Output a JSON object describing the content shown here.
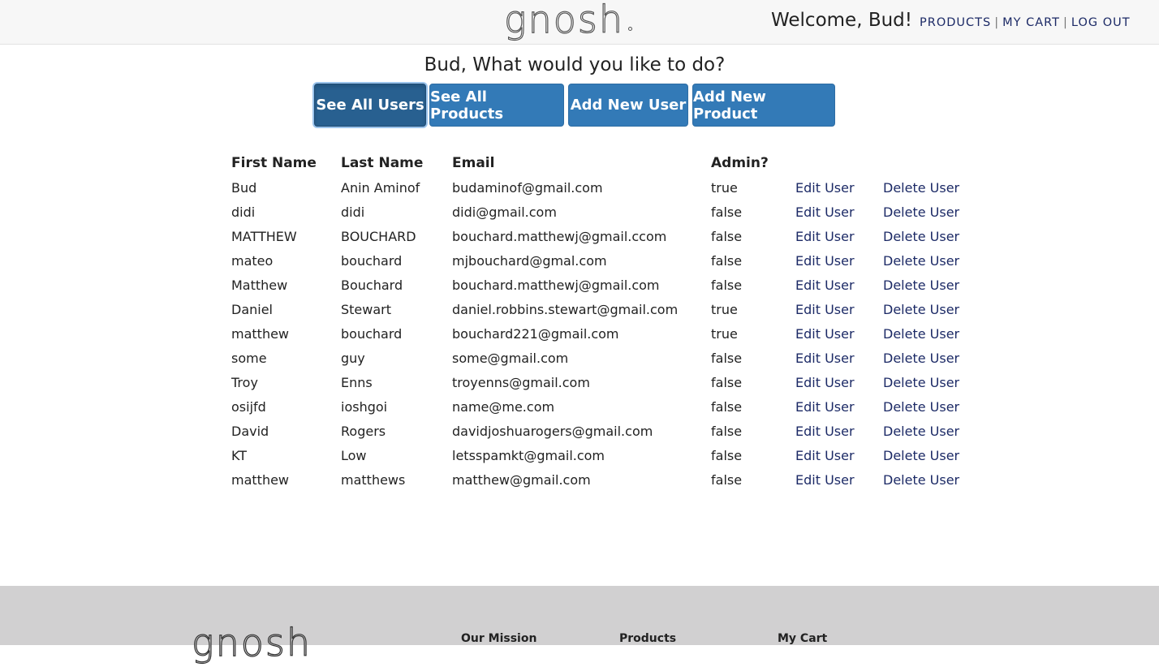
{
  "header": {
    "logo": "gnosh",
    "welcome": "Welcome, Bud!",
    "nav": [
      "PRODUCTS",
      "MY CART",
      "LOG OUT"
    ]
  },
  "prompt": "Bud, What would you like to do?",
  "actions": {
    "see_all_users": "See All Users",
    "see_all_products": "See All Products",
    "add_new_user": "Add New User",
    "add_new_product": "Add New Product"
  },
  "table": {
    "headers": [
      "First Name",
      "Last Name",
      "Email",
      "Admin?"
    ],
    "edit_label": "Edit User",
    "delete_label": "Delete User",
    "rows": [
      {
        "first": "Bud",
        "last": "Anin Aminof",
        "email": "budaminof@gmail.com",
        "admin": "true"
      },
      {
        "first": "didi",
        "last": "didi",
        "email": "didi@gmail.com",
        "admin": "false"
      },
      {
        "first": "MATTHEW",
        "last": "BOUCHARD",
        "email": "bouchard.matthewj@gmail.ccom",
        "admin": "false"
      },
      {
        "first": "mateo",
        "last": "bouchard",
        "email": "mjbouchard@gmal.com",
        "admin": "false"
      },
      {
        "first": "Matthew",
        "last": "Bouchard",
        "email": "bouchard.matthewj@gmail.com",
        "admin": "false"
      },
      {
        "first": "Daniel",
        "last": "Stewart",
        "email": "daniel.robbins.stewart@gmail.com",
        "admin": "true"
      },
      {
        "first": "matthew",
        "last": "bouchard",
        "email": "bouchard221@gmail.com",
        "admin": "true"
      },
      {
        "first": "some",
        "last": "guy",
        "email": "some@gmail.com",
        "admin": "false"
      },
      {
        "first": "Troy",
        "last": "Enns",
        "email": "troyenns@gmail.com",
        "admin": "false"
      },
      {
        "first": "osijfd",
        "last": "ioshgoi",
        "email": "name@me.com",
        "admin": "false"
      },
      {
        "first": "David",
        "last": "Rogers",
        "email": "davidjoshuarogers@gmail.com",
        "admin": "false"
      },
      {
        "first": "KT",
        "last": "Low",
        "email": "letsspamkt@gmail.com",
        "admin": "false"
      },
      {
        "first": "matthew",
        "last": "matthews",
        "email": "matthew@gmail.com",
        "admin": "false"
      }
    ]
  },
  "footer": {
    "logo": "gnosh",
    "links": [
      "Our Mission",
      "Products",
      "My Cart"
    ]
  },
  "colors": {
    "primary_button": "#337ab7",
    "active_button": "#286090",
    "link": "#1c2a66",
    "header_bg": "#f7f7f7",
    "footer_bg": "#d1d0d1"
  }
}
